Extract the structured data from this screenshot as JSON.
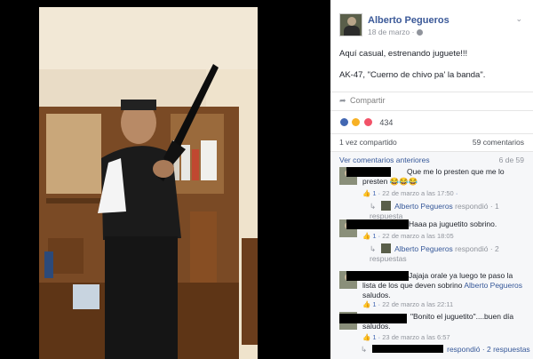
{
  "post": {
    "author": "Alberto Pegueros",
    "date": "18 de marzo ·",
    "text_line1": "Aquí casual, estrenando juguete!!!",
    "text_line2": "AK-47, \"Cuerno de chivo pa' la banda\".",
    "share_label": "Compartir",
    "reaction_count": "434",
    "shares": "1 vez compartido",
    "comments_count": "59 comentarios",
    "menu_icon": "chevron-down-icon",
    "share_icon": "share-arrow-icon"
  },
  "comments_panel": {
    "previous_label": "Ver comentarios anteriores",
    "page_count": "6 de 59",
    "comments": [
      {
        "text": "Que me lo presten que me lo presten 😂😂😂",
        "meta_a": "👍 1 · ",
        "meta_b": "22 de marzo a las 17:50",
        "reply_author": "Alberto Pegueros",
        "reply_text": " respondió · 1 respuesta"
      },
      {
        "text": "Haaa pa juguetito sobrino.",
        "meta_a": "👍 1 · ",
        "meta_b": "22 de marzo a las 18:05",
        "reply_author": "Alberto Pegueros",
        "reply_text": " respondió · 2 respuestas"
      },
      {
        "text": "Jajaja orale ya luego te paso la lista de los que deven sobrino ",
        "mention": "Alberto Pegueros",
        "text_end": " saludos.",
        "meta_a": "👍 1 · ",
        "meta_b": "22 de marzo a las 22:11"
      },
      {
        "text": "\"Bonito el juguetito\"....buen día saludos.",
        "meta_a": "👍 1 · ",
        "meta_b": "23 de marzo a las 6:57"
      },
      {
        "reply_text": "respondió · 2 respuestas"
      }
    ]
  },
  "colors": {
    "link": "#365899",
    "author": "#3b5998",
    "meta": "#90949c",
    "panel_bg": "#f6f7f9"
  }
}
